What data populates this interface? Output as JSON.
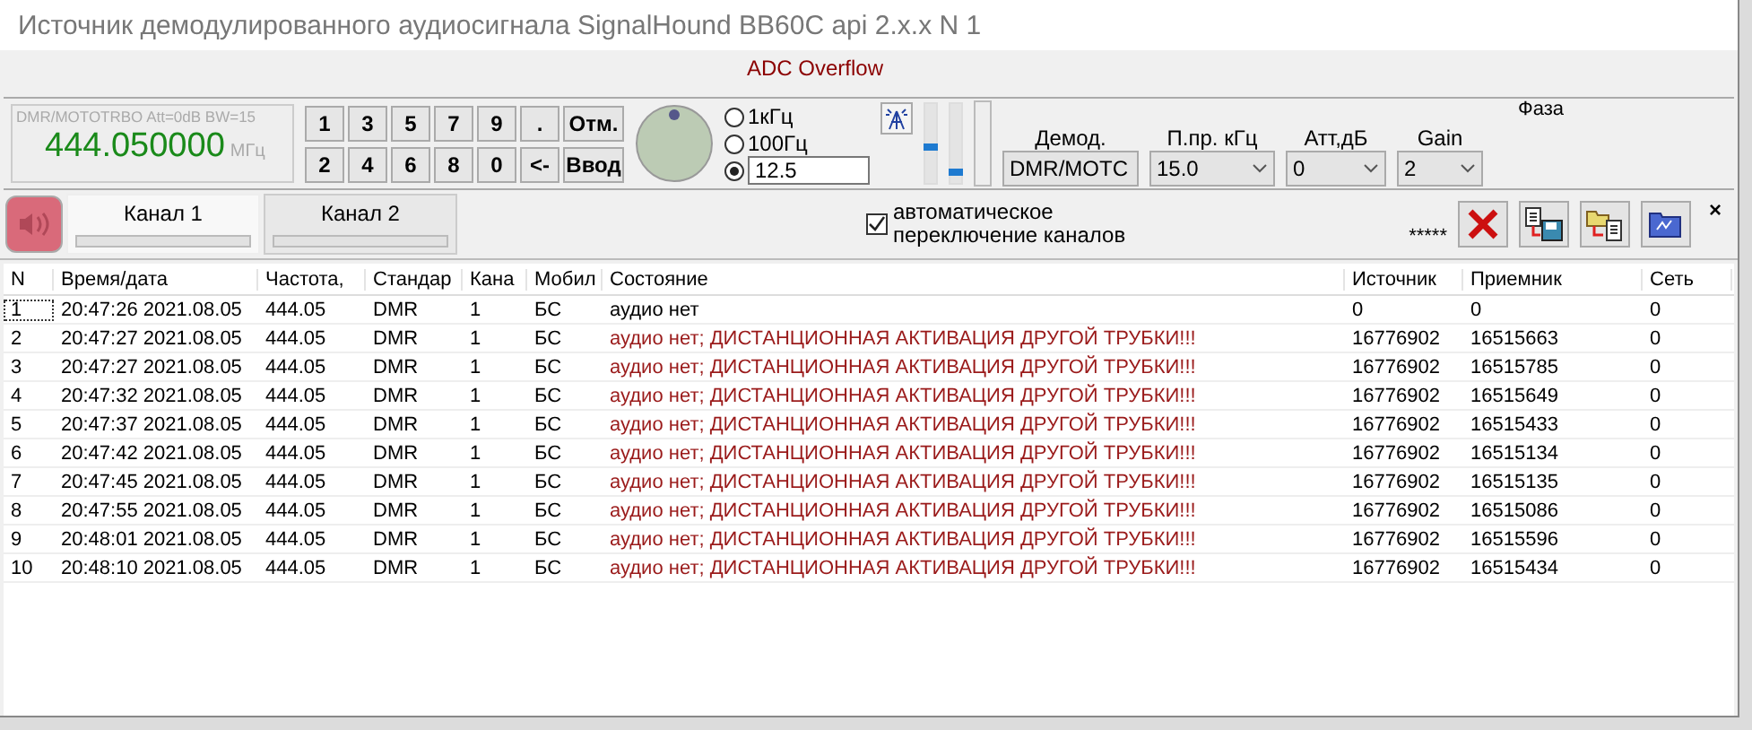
{
  "window": {
    "title": "Источник демодулированного аудиосигнала SignalHound BB60C api 2.x.x N 1"
  },
  "alert": "ADC Overflow",
  "frequency": {
    "mode": "DMR/MOTOTRBO Att=0dB BW=15",
    "value": "444.050000",
    "unit": "МГц"
  },
  "keypad": [
    [
      "1",
      "3",
      "5",
      "7",
      "9",
      ".",
      "Отм."
    ],
    [
      "2",
      "4",
      "6",
      "8",
      "0",
      "<-",
      "Ввод"
    ]
  ],
  "steps": [
    {
      "label": "1кГц",
      "selected": false
    },
    {
      "label": "100Гц",
      "selected": false
    },
    {
      "value": "12.5",
      "selected": true
    }
  ],
  "sliders": [
    {
      "level": 0.45
    },
    {
      "level": 0.1
    }
  ],
  "dropdowns": [
    {
      "label": "Демод.",
      "value": "DMR/MOTC"
    },
    {
      "label": "П.пр. кГц",
      "value": "15.0"
    },
    {
      "label": "Атт,дБ",
      "value": "0"
    },
    {
      "label": "Gain",
      "value": "2"
    }
  ],
  "phase_label": "Фаза",
  "speaker": {
    "on": true
  },
  "tabs": [
    {
      "label": "Канал 1",
      "selected": true
    },
    {
      "label": "Канал 2",
      "selected": false
    }
  ],
  "auto_switch": {
    "label": "автоматическое\nпереключение каналов",
    "checked": true
  },
  "stars": "*****",
  "close": "×",
  "table": {
    "columns": [
      "N",
      "Время/дата",
      "Частота,",
      "Стандар",
      "Кана",
      "Мобил",
      "Состояние",
      "Источник",
      "Приемник",
      "Сеть"
    ],
    "rows": [
      {
        "selected": true,
        "alert": false,
        "cells": [
          "1",
          "20:47:26 2021.08.05",
          "444.05",
          "DMR",
          "1",
          "БС",
          "аудио нет",
          "0",
          "0",
          "0"
        ]
      },
      {
        "selected": false,
        "alert": true,
        "cells": [
          "2",
          "20:47:27 2021.08.05",
          "444.05",
          "DMR",
          "1",
          "БС",
          "аудио нет; ДИСТАНЦИОННАЯ АКТИВАЦИЯ ДРУГОЙ ТРУБКИ!!!",
          "16776902",
          "16515663",
          "0"
        ]
      },
      {
        "selected": false,
        "alert": true,
        "cells": [
          "3",
          "20:47:27 2021.08.05",
          "444.05",
          "DMR",
          "1",
          "БС",
          "аудио нет; ДИСТАНЦИОННАЯ АКТИВАЦИЯ ДРУГОЙ ТРУБКИ!!!",
          "16776902",
          "16515785",
          "0"
        ]
      },
      {
        "selected": false,
        "alert": true,
        "cells": [
          "4",
          "20:47:32 2021.08.05",
          "444.05",
          "DMR",
          "1",
          "БС",
          "аудио нет; ДИСТАНЦИОННАЯ АКТИВАЦИЯ ДРУГОЙ ТРУБКИ!!!",
          "16776902",
          "16515649",
          "0"
        ]
      },
      {
        "selected": false,
        "alert": true,
        "cells": [
          "5",
          "20:47:37 2021.08.05",
          "444.05",
          "DMR",
          "1",
          "БС",
          "аудио нет; ДИСТАНЦИОННАЯ АКТИВАЦИЯ ДРУГОЙ ТРУБКИ!!!",
          "16776902",
          "16515433",
          "0"
        ]
      },
      {
        "selected": false,
        "alert": true,
        "cells": [
          "6",
          "20:47:42 2021.08.05",
          "444.05",
          "DMR",
          "1",
          "БС",
          "аудио нет; ДИСТАНЦИОННАЯ АКТИВАЦИЯ ДРУГОЙ ТРУБКИ!!!",
          "16776902",
          "16515134",
          "0"
        ]
      },
      {
        "selected": false,
        "alert": true,
        "cells": [
          "7",
          "20:47:45 2021.08.05",
          "444.05",
          "DMR",
          "1",
          "БС",
          "аудио нет; ДИСТАНЦИОННАЯ АКТИВАЦИЯ ДРУГОЙ ТРУБКИ!!!",
          "16776902",
          "16515135",
          "0"
        ]
      },
      {
        "selected": false,
        "alert": true,
        "cells": [
          "8",
          "20:47:55 2021.08.05",
          "444.05",
          "DMR",
          "1",
          "БС",
          "аудио нет; ДИСТАНЦИОННАЯ АКТИВАЦИЯ ДРУГОЙ ТРУБКИ!!!",
          "16776902",
          "16515086",
          "0"
        ]
      },
      {
        "selected": false,
        "alert": true,
        "cells": [
          "9",
          "20:48:01 2021.08.05",
          "444.05",
          "DMR",
          "1",
          "БС",
          "аудио нет; ДИСТАНЦИОННАЯ АКТИВАЦИЯ ДРУГОЙ ТРУБКИ!!!",
          "16776902",
          "16515596",
          "0"
        ]
      },
      {
        "selected": false,
        "alert": true,
        "cells": [
          "10",
          "20:48:10 2021.08.05",
          "444.05",
          "DMR",
          "1",
          "БС",
          "аудио нет; ДИСТАНЦИОННАЯ АКТИВАЦИЯ ДРУГОЙ ТРУБКИ!!!",
          "16776902",
          "16515434",
          "0"
        ]
      }
    ]
  }
}
